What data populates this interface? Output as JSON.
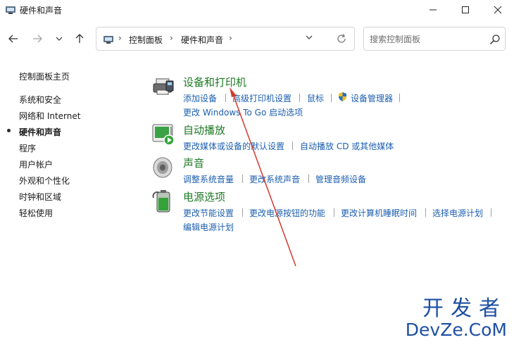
{
  "window": {
    "title": "硬件和声音"
  },
  "address_bar": {
    "crumbs": [
      "控制面板",
      "硬件和声音"
    ]
  },
  "search": {
    "placeholder": "搜索控制面板"
  },
  "sidebar": {
    "items": [
      {
        "label": "控制面板主页"
      },
      {
        "label": "系统和安全"
      },
      {
        "label": "网络和 Internet"
      },
      {
        "label": "硬件和声音",
        "active": true
      },
      {
        "label": "程序"
      },
      {
        "label": "用户帐户"
      },
      {
        "label": "外观和个性化"
      },
      {
        "label": "时钟和区域"
      },
      {
        "label": "轻松使用"
      }
    ]
  },
  "categories": [
    {
      "title": "设备和打印机",
      "icon": "printer-icon",
      "links": [
        "添加设备",
        "高级打印机设置",
        "鼠标",
        "设备管理器",
        "更改 Windows To Go 启动选项"
      ]
    },
    {
      "title": "自动播放",
      "icon": "autoplay-icon",
      "links": [
        "更改媒体或设备的默认设置",
        "自动播放 CD 或其他媒体"
      ]
    },
    {
      "title": "声音",
      "icon": "speaker-icon",
      "links": [
        "调整系统音量",
        "更改系统声音",
        "管理音频设备"
      ]
    },
    {
      "title": "电源选项",
      "icon": "battery-icon",
      "links": [
        "更改节能设置",
        "更改电源按钮的功能",
        "更改计算机睡眠时间",
        "选择电源计划",
        "编辑电源计划"
      ]
    }
  ],
  "watermark": {
    "line1": "开发者",
    "line2": "DevZe.CoM"
  },
  "colors": {
    "category_title": "#1e7a25",
    "link": "#1c5fb0",
    "arrow": "#d23a2e",
    "watermark": "#1d4fa3"
  }
}
